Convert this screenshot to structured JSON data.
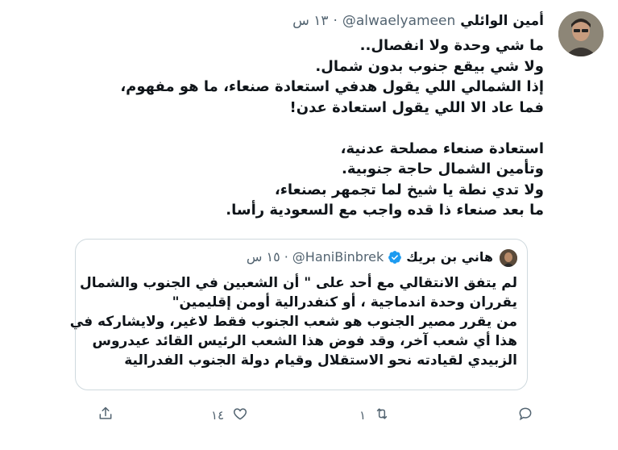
{
  "tweet": {
    "author_name": "أمين الوائلي",
    "handle": "@alwaelyameen",
    "time": "١٣ س",
    "lines": [
      "ما شي وحدة ولا انفصال..",
      "ولا شي بيقع جنوب بدون شمال.",
      "إذا الشمالي اللي يقول هدفي استعادة صنعاء، ما هو مفهوم،",
      "فما عاد الا اللي يقول استعادة عدن!",
      "",
      "استعادة صنعاء مصلحة عدنية،",
      "وتأمين الشمال حاجة جنوبية.",
      "ولا تدي نطة يا شيخ لما تجمهر بصنعاء،",
      "ما بعد صنعاء ذا قده واجب مع السعودية رأسا."
    ]
  },
  "quoted": {
    "author_name": "هاني بن بريك",
    "handle": "@HaniBinbrek",
    "time": "١٥ س",
    "lines": [
      "لم يتفق الانتقالي مع أحد على \" أن الشعبين في الجنوب والشمال",
      "يقرران وحدة اندماجية ، أو كنفدرالية أومن إقليمين\"",
      "من يقرر مصير الجنوب هو شعب الجنوب فقط لاغير، ولايشاركه في",
      "هذا أي شعب آخر، وقد فوض هذا الشعب الرئيس القائد عيدروس",
      "الزبيدي لقيادته نحو الاستقلال وقيام دولة الجنوب الفدرالية"
    ]
  },
  "actions": {
    "reply_count": "",
    "retweet_count": "١",
    "like_count": "١٤"
  },
  "icons": {
    "reply": "reply-icon",
    "retweet": "retweet-icon",
    "like": "heart-icon",
    "share": "share-icon",
    "verified": "verified-badge-icon"
  },
  "colors": {
    "text": "#0f1419",
    "secondary": "#536471",
    "border": "#cfd9de",
    "verified": "#1d9bf0"
  }
}
